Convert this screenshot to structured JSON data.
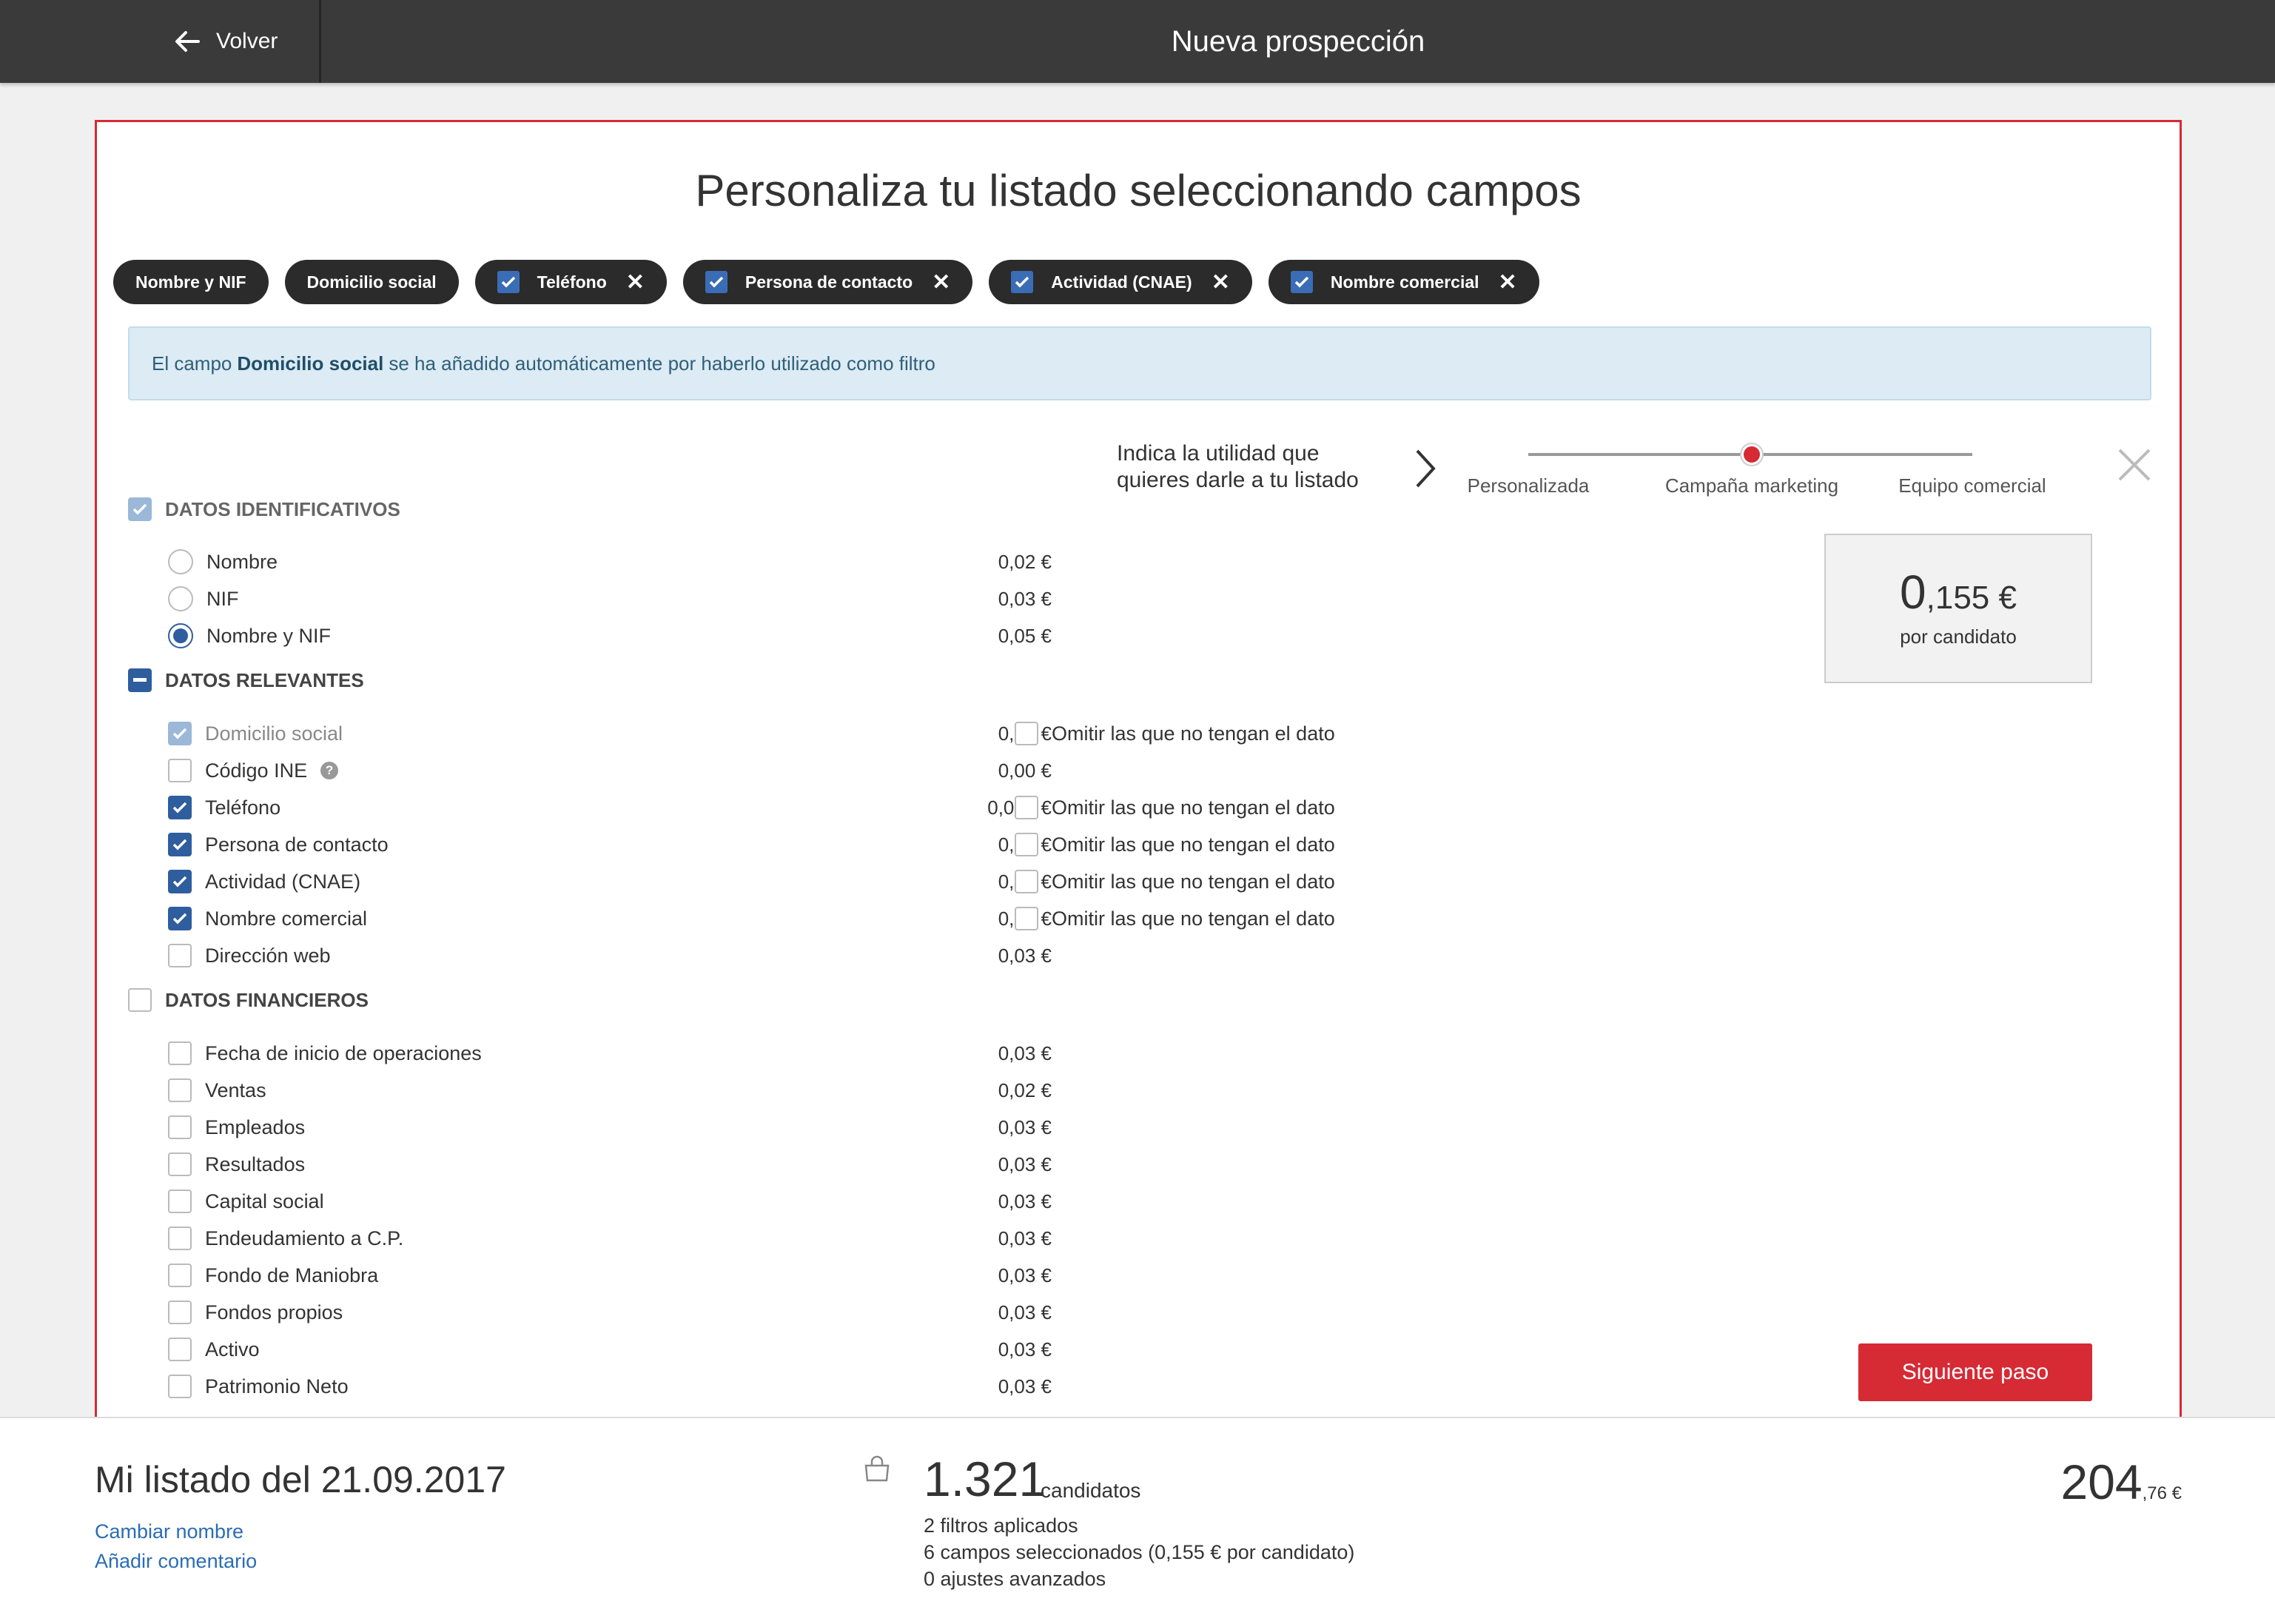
{
  "header": {
    "back_label": "Volver",
    "title": "Nueva prospección"
  },
  "card": {
    "title": "Personaliza tu listado seleccionando campos",
    "chips": [
      {
        "label": "Nombre y NIF",
        "removable": false
      },
      {
        "label": "Domicilio social",
        "removable": false
      },
      {
        "label": "Teléfono",
        "removable": true
      },
      {
        "label": "Persona de contacto",
        "removable": true
      },
      {
        "label": "Actividad (CNAE)",
        "removable": true
      },
      {
        "label": "Nombre comercial",
        "removable": true
      }
    ],
    "info": {
      "prefix": "El campo",
      "field": "Domicilio social",
      "suffix": "se ha añadido automáticamente por haberlo utilizado como filtro"
    },
    "usage": {
      "line1": "Indica la utilidad que",
      "line2": "quieres darle a tu listado",
      "options": [
        "Personalizada",
        "Campaña marketing",
        "Equipo comercial"
      ],
      "selected": "Campaña marketing"
    },
    "price_box": {
      "integer": "0",
      "decimals": ",155 €",
      "label": "por candidato"
    },
    "omit_label": "Omitir las que no tengan el dato",
    "sections": {
      "identificativos": {
        "title": "DATOS IDENTIFICATIVOS",
        "items": [
          {
            "label": "Nombre",
            "price": "0,02 €",
            "state": "off"
          },
          {
            "label": "NIF",
            "price": "0,03 €",
            "state": "off"
          },
          {
            "label": "Nombre y NIF",
            "price": "0,05 €",
            "state": "on"
          }
        ]
      },
      "relevantes": {
        "title": "DATOS RELEVANTES",
        "items": [
          {
            "label": "Domicilio social",
            "price": "0,02 €",
            "state": "disabled"
          },
          {
            "label": "Código INE",
            "price": "0,00 €",
            "state": "off",
            "help": "?"
          },
          {
            "label": "Teléfono",
            "price": "0,015 €",
            "state": "on"
          },
          {
            "label": "Persona de contacto",
            "price": "0,03 €",
            "state": "on"
          },
          {
            "label": "Actividad (CNAE)",
            "price": "0,02 €",
            "state": "on"
          },
          {
            "label": "Nombre comercial",
            "price": "0,02 €",
            "state": "on"
          },
          {
            "label": "Dirección web",
            "price": "0,03 €",
            "state": "off"
          }
        ]
      },
      "financieros": {
        "title": "DATOS FINANCIEROS",
        "items": [
          {
            "label": "Fecha de inicio de operaciones",
            "price": "0,03 €"
          },
          {
            "label": "Ventas",
            "price": "0,02 €"
          },
          {
            "label": "Empleados",
            "price": "0,03 €"
          },
          {
            "label": "Resultados",
            "price": "0,03 €"
          },
          {
            "label": "Capital social",
            "price": "0,03 €"
          },
          {
            "label": "Endeudamiento a C.P.",
            "price": "0,03 €"
          },
          {
            "label": "Fondo de Maniobra",
            "price": "0,03 €"
          },
          {
            "label": "Fondos propios",
            "price": "0,03 €"
          },
          {
            "label": "Activo",
            "price": "0,03 €"
          },
          {
            "label": "Patrimonio Neto",
            "price": "0,03 €"
          }
        ]
      }
    },
    "next_button": "Siguiente paso"
  },
  "footer": {
    "list_name": "Mi listado del 21.09.2017",
    "rename_link": "Cambiar nombre",
    "comment_link": "Añadir comentario",
    "candidates_count": "1.321",
    "candidates_label": "candidatos",
    "filters": "2 filtros aplicados",
    "fields": "6 campos seleccionados (0,155 € por candidato)",
    "adjustments": "0 ajustes avanzados",
    "total_integer": "204",
    "total_decimals": ",76 €"
  },
  "colors": {
    "accent": "#d62a35",
    "primary": "#2f5e9f",
    "header_bg": "#3a3a3a",
    "info_bg": "#dcebf4"
  }
}
